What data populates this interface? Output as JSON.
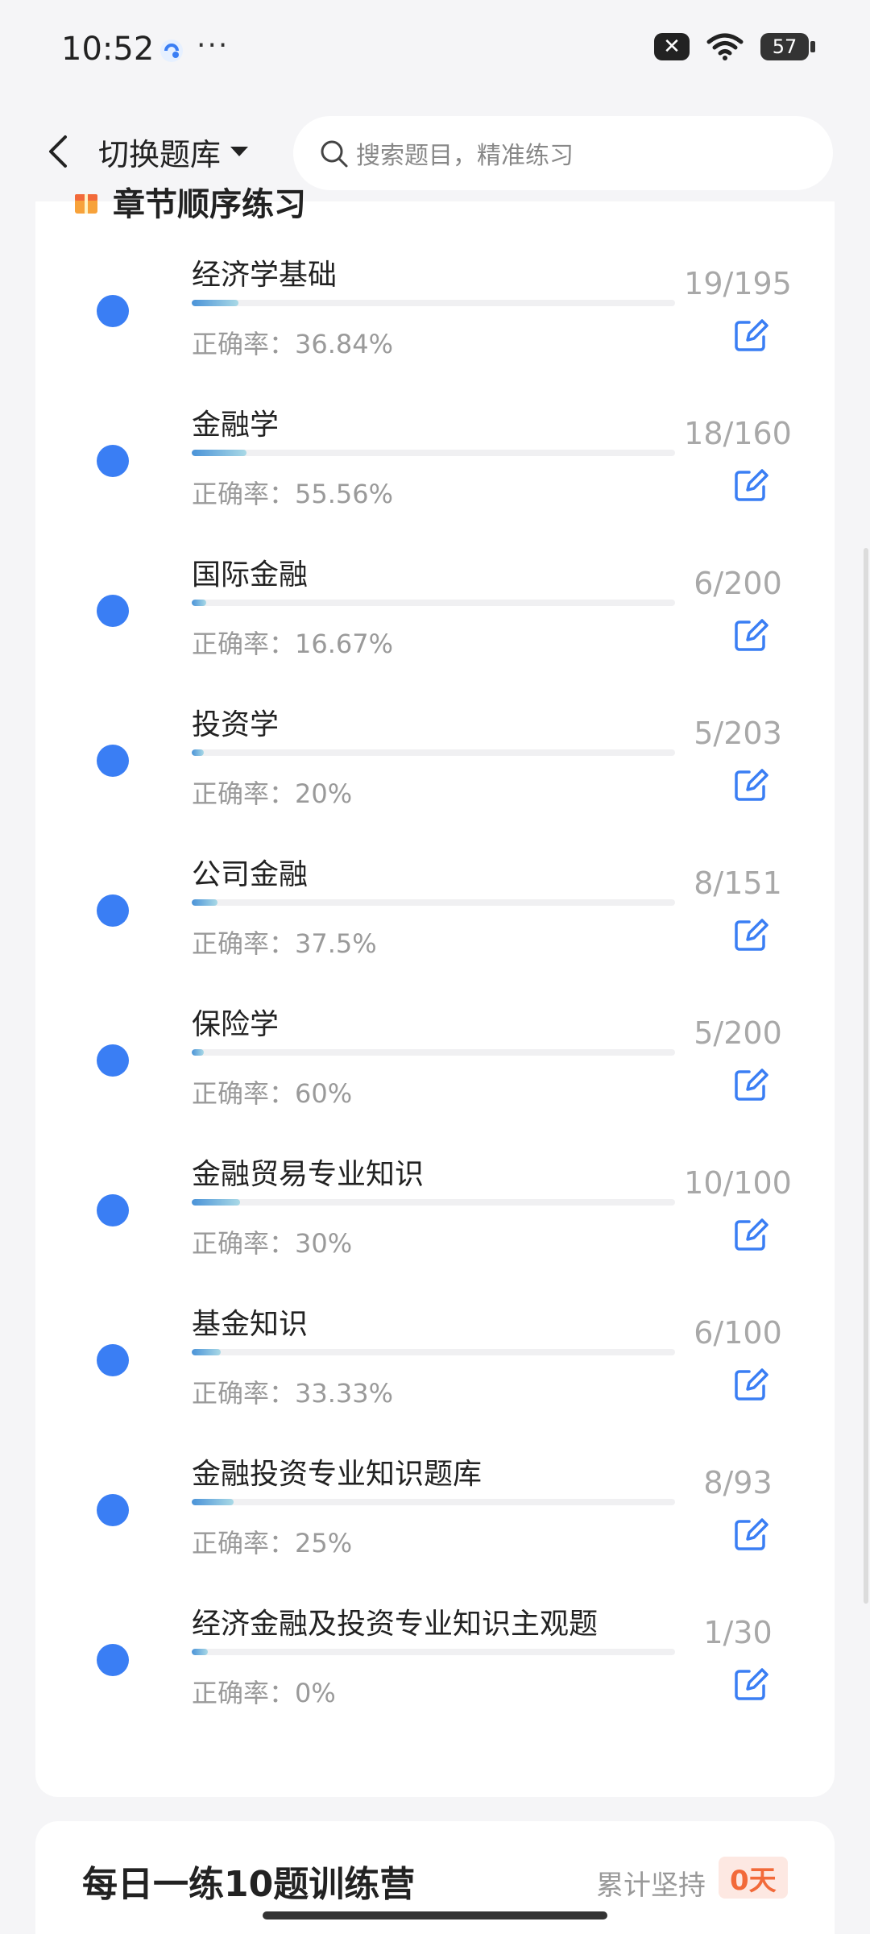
{
  "status_bar": {
    "time": "10:52",
    "dots": "···",
    "close_badge": "✕",
    "battery": "57"
  },
  "header": {
    "switch_label": "切换题库",
    "search_placeholder": "搜索题目，精准练习"
  },
  "card": {
    "title": "章节顺序练习",
    "accent_color": "#3a7ef4"
  },
  "chapters": [
    {
      "name": "经济学基础",
      "accuracy": "正确率：36.84%",
      "count": "19/195",
      "progress": 0.097
    },
    {
      "name": "金融学",
      "accuracy": "正确率：55.56%",
      "count": "18/160",
      "progress": 0.113
    },
    {
      "name": "国际金融",
      "accuracy": "正确率：16.67%",
      "count": "6/200",
      "progress": 0.03
    },
    {
      "name": "投资学",
      "accuracy": "正确率：20%",
      "count": "5/203",
      "progress": 0.025
    },
    {
      "name": "公司金融",
      "accuracy": "正确率：37.5%",
      "count": "8/151",
      "progress": 0.053
    },
    {
      "name": "保险学",
      "accuracy": "正确率：60%",
      "count": "5/200",
      "progress": 0.025
    },
    {
      "name": "金融贸易专业知识",
      "accuracy": "正确率：30%",
      "count": "10/100",
      "progress": 0.1
    },
    {
      "name": "基金知识",
      "accuracy": "正确率：33.33%",
      "count": "6/100",
      "progress": 0.06
    },
    {
      "name": "金融投资专业知识题库",
      "accuracy": "正确率：25%",
      "count": "8/93",
      "progress": 0.086
    },
    {
      "name": "经济金融及投资专业知识主观题",
      "accuracy": "正确率：0%",
      "count": "1/30",
      "progress": 0.033
    }
  ],
  "camp": {
    "title": "每日一练10题训练营",
    "persist_label": "累计坚持",
    "persist_days": "0天"
  }
}
